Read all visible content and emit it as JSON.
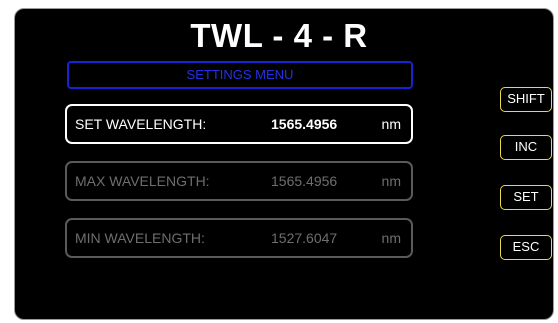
{
  "header": {
    "title": "TWL - 4 - R"
  },
  "menu": {
    "banner": "SETTINGS MENU"
  },
  "fields": [
    {
      "label": "SET WAVELENGTH:",
      "value": "1565.4956",
      "unit": "nm",
      "active": true
    },
    {
      "label": "MAX WAVELENGTH:",
      "value": "1565.4956",
      "unit": "nm",
      "active": false
    },
    {
      "label": "MIN WAVELENGTH:",
      "value": "1527.6047",
      "unit": "nm",
      "active": false
    }
  ],
  "buttons": {
    "shift": "SHIFT",
    "inc": "INC",
    "set": "SET",
    "esc": "ESC"
  },
  "colors": {
    "background": "#000000",
    "banner_border": "#1a22d8",
    "banner_text": "#2431e6",
    "button_border": "#e8d84a",
    "active_text": "#ffffff",
    "inactive_text": "#6e6e6e"
  }
}
